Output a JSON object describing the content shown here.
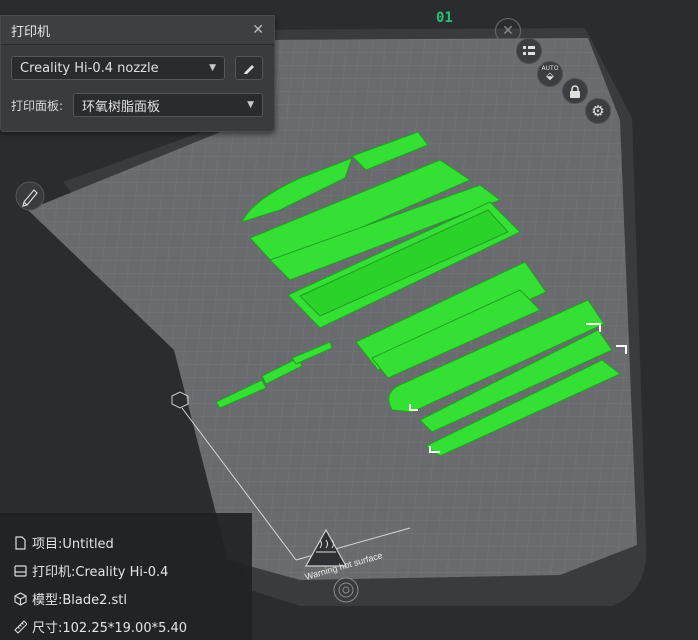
{
  "printer_panel": {
    "title": "打印机",
    "nozzle": "Creality Hi-0.4 nozzle",
    "plate_label": "打印面板:",
    "plate_value": "环氧树脂面板"
  },
  "plate": {
    "number": "01",
    "warning_text": "Warning hot surface"
  },
  "side_tools": {
    "auto_label": "AUTO"
  },
  "info": {
    "project": "项目:Untitled",
    "printer": "打印机:Creality Hi-0.4",
    "model": "模型:Blade2.stl",
    "size": "尺寸:102.25*19.00*5.40"
  },
  "colors": {
    "model": "#33e033",
    "background": "#2b2c2e",
    "plate": "#6a6b6e",
    "plate_number": "#27c07a"
  }
}
